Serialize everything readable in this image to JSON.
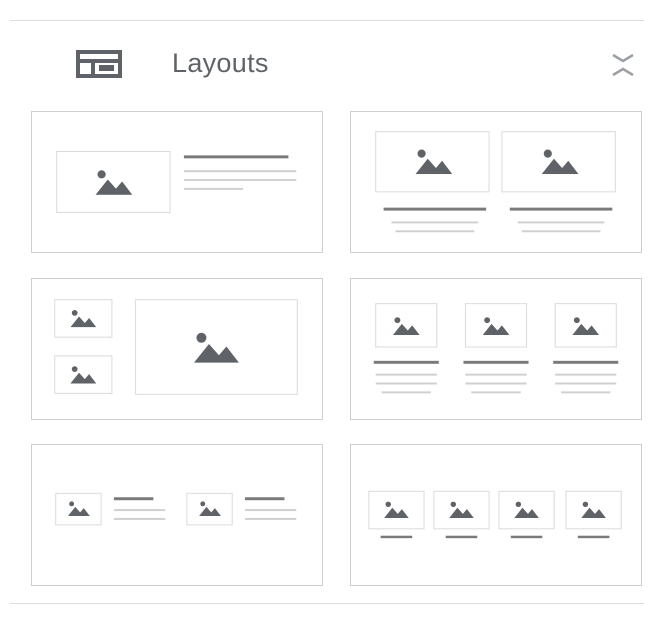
{
  "panel": {
    "title": "Layouts",
    "header_icon": "layouts-icon",
    "collapse_icon": "collapse-chevrons-icon"
  },
  "layouts": [
    {
      "id": "layout-image-left-text-right",
      "icon": "image-placeholder-icon"
    },
    {
      "id": "layout-two-columns",
      "icon": "image-placeholder-icon"
    },
    {
      "id": "layout-two-small-one-large",
      "icon": "image-placeholder-icon"
    },
    {
      "id": "layout-three-columns",
      "icon": "image-placeholder-icon"
    },
    {
      "id": "layout-two-image-text-pairs",
      "icon": "image-placeholder-icon"
    },
    {
      "id": "layout-four-columns",
      "icon": "image-placeholder-icon"
    }
  ],
  "colors": {
    "icon_gray": "#5f6368",
    "line_dark": "#7a7a7a",
    "line_light": "#d0d0d0",
    "frame_border": "#dadada"
  }
}
